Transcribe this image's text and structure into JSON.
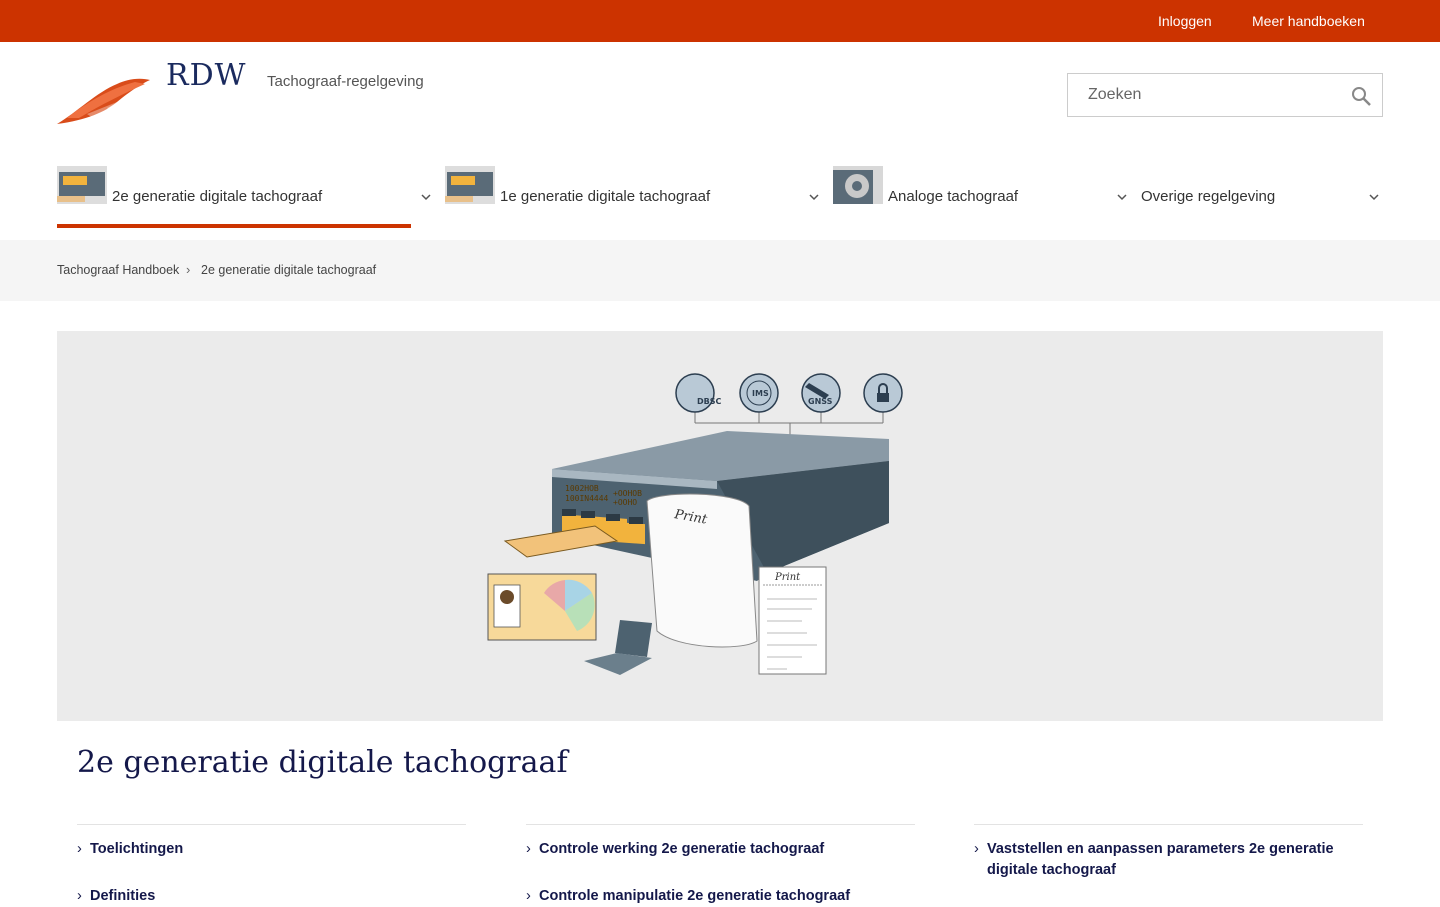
{
  "topbar": {
    "login": "Inloggen",
    "more": "Meer handboeken"
  },
  "header": {
    "logo_text": "RDW",
    "subtitle": "Tachograaf-regelgeving"
  },
  "search": {
    "placeholder": "Zoeken"
  },
  "nav": {
    "items": [
      {
        "label": "2e generatie digitale tachograaf",
        "active": true
      },
      {
        "label": "1e generatie digitale tachograaf"
      },
      {
        "label": "Analoge tachograaf"
      },
      {
        "label": "Overige regelgeving"
      }
    ]
  },
  "breadcrumb": {
    "items": [
      "Tachograaf Handboek",
      "2e generatie digitale tachograaf"
    ]
  },
  "hero": {
    "display_top": "1002HOB",
    "display_bottom": "100IN4444",
    "display_right_top": "+OOHOB",
    "display_right_bottom": "+OOHO",
    "print_label": "Print",
    "icon_labels": [
      "DBSC",
      "IMS",
      "GNSS",
      ""
    ]
  },
  "page_title": "2e generatie digitale tachograaf",
  "columns": [
    {
      "links": [
        "Toelichtingen",
        "Definities"
      ]
    },
    {
      "links": [
        "Controle werking 2e generatie tachograaf",
        "Controle manipulatie 2e generatie tachograaf"
      ]
    },
    {
      "links": [
        "Vaststellen en aanpassen parameters 2e generatie digitale tachograaf"
      ]
    }
  ],
  "colors": {
    "brand": "#cc3300",
    "title": "#14184a",
    "logo_text": "#1a2a5e"
  },
  "icons": [
    "search-icon",
    "chevron-down-icon",
    "rdw-logo-icon"
  ]
}
